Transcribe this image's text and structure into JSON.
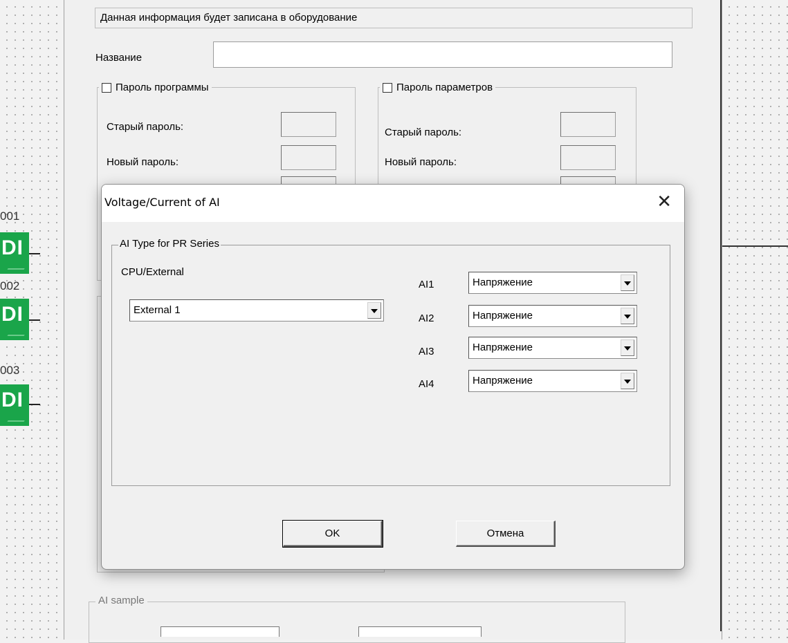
{
  "left_blocks": [
    {
      "label": "001",
      "tag": "DI"
    },
    {
      "label": "002",
      "tag": "DI"
    },
    {
      "label": "003",
      "tag": "DI"
    }
  ],
  "background_dialog": {
    "info_text": "Данная информация будет записана в оборудование",
    "name_label": "Название",
    "name_value": "",
    "program_password": {
      "title": "Пароль программы",
      "old_label": "Старый пароль:",
      "new_label": "Новый пароль:"
    },
    "param_password": {
      "title": "Пароль параметров",
      "old_label": "Старый пароль:",
      "new_label": "Новый пароль:"
    },
    "ai_sample_title": "AI sample"
  },
  "modal": {
    "title": "Voltage/Current of AI",
    "close_symbol": "✕",
    "group_title": "AI Type for PR Series",
    "cpu_label": "CPU/External",
    "cpu_value": "External 1",
    "channels": [
      {
        "label": "AI1",
        "value": "Напряжение"
      },
      {
        "label": "AI2",
        "value": "Напряжение"
      },
      {
        "label": "AI3",
        "value": "Напряжение"
      },
      {
        "label": "AI4",
        "value": "Напряжение"
      }
    ],
    "ok_label": "OK",
    "cancel_label": "Отмена"
  },
  "colors": {
    "block_green": "#1aa54a",
    "dialog_bg": "#f0f0f0"
  }
}
